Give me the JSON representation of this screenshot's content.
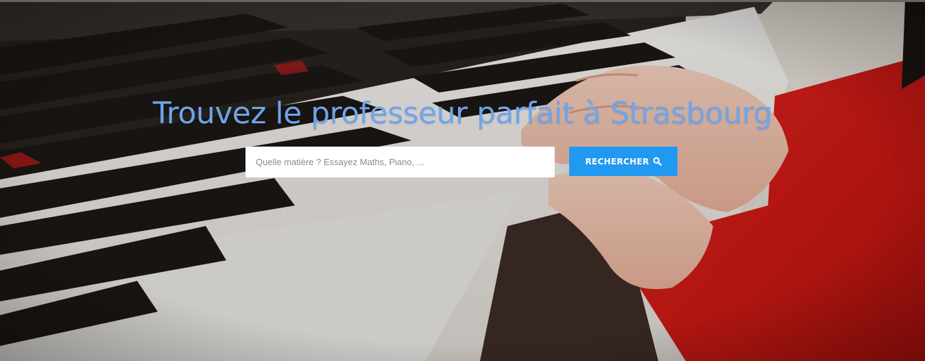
{
  "hero": {
    "title": "Trouvez le professeur parfait à Strasbourg",
    "background_image": "piano-keys-child-hands-photo"
  },
  "search": {
    "placeholder": "Quelle matière ? Essayez Maths, Piano, ...",
    "value": "",
    "button_label": "RECHERCHER",
    "button_icon": "search-icon"
  },
  "colors": {
    "title": "#6ea5ea",
    "button": "#2299f0",
    "button_text": "#ffffff",
    "input_background": "#ffffff"
  }
}
